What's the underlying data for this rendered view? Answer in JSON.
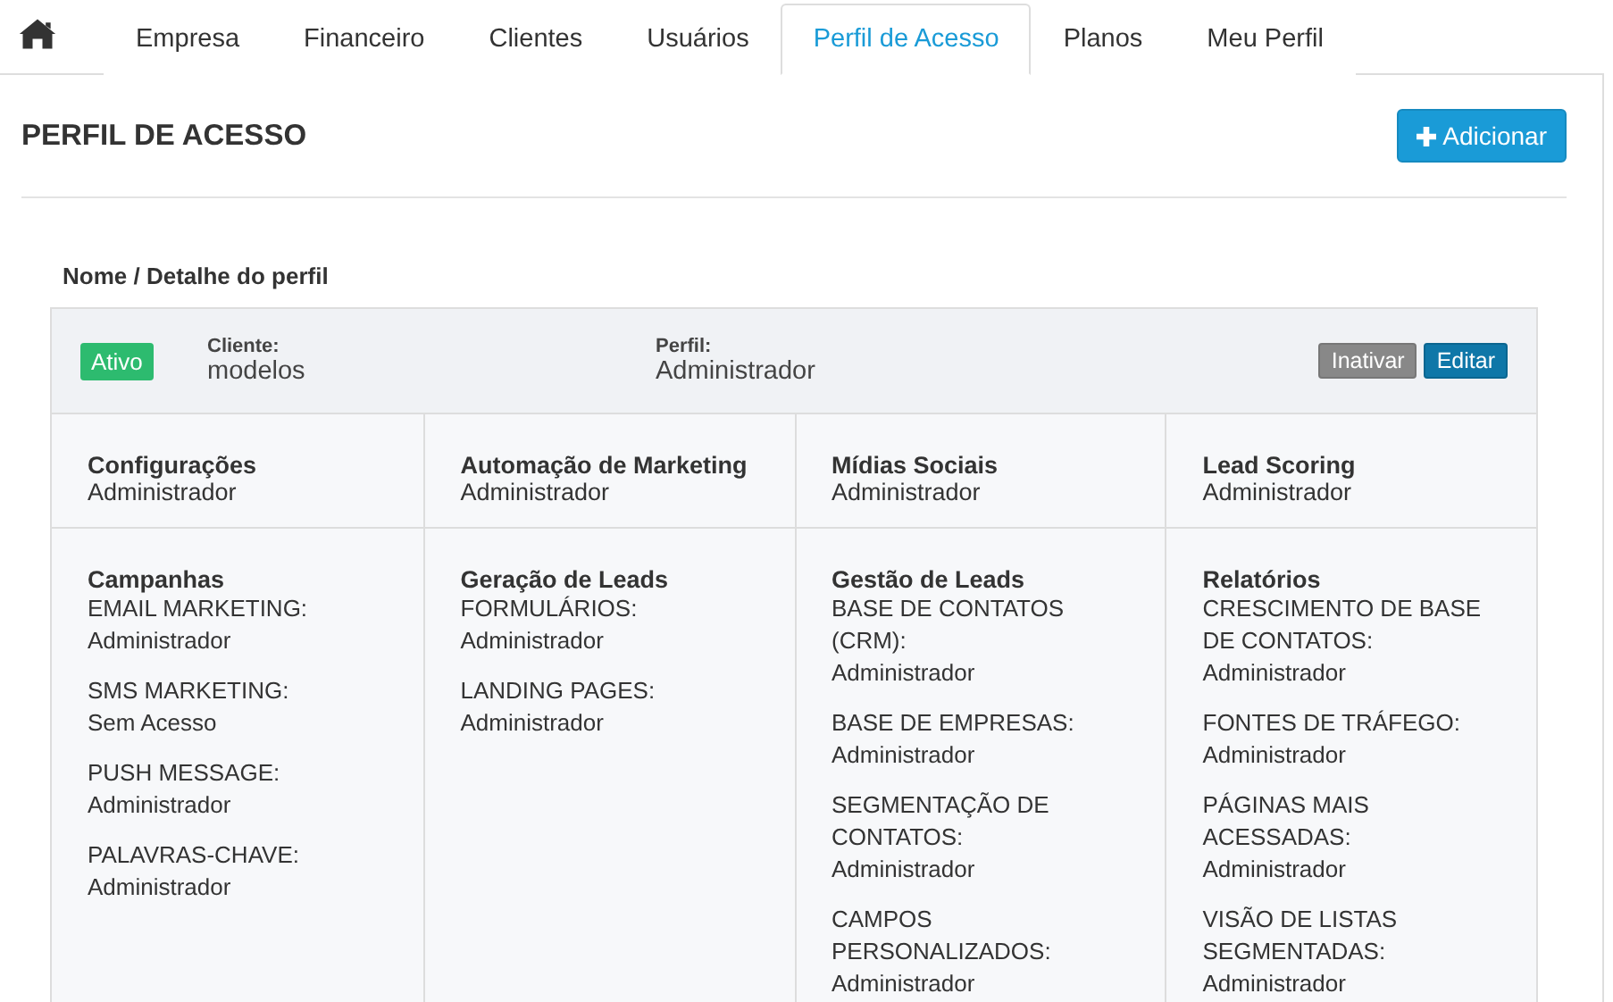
{
  "tabs": [
    {
      "label": "Empresa",
      "selected": false
    },
    {
      "label": "Financeiro",
      "selected": false
    },
    {
      "label": "Clientes",
      "selected": false
    },
    {
      "label": "Usuários",
      "selected": false
    },
    {
      "label": "Perfil de Acesso",
      "selected": true
    },
    {
      "label": "Planos",
      "selected": false
    },
    {
      "label": "Meu Perfil",
      "selected": false
    }
  ],
  "page_title": "PERFIL DE ACESSO",
  "add_button": "Adicionar",
  "section_label": "Nome / Detalhe do perfil",
  "profile": {
    "status": "Ativo",
    "client_label": "Cliente:",
    "client": "modelos",
    "profile_label": "Perfil:",
    "profile": "Administrador",
    "buttons": [
      "Inativar",
      "Editar"
    ]
  },
  "permission_rows": [
    [
      {
        "title": "Configurações",
        "value": "Administrador"
      },
      {
        "title": "Automação de Marketing",
        "value": "Administrador"
      },
      {
        "title": "Mídias Sociais",
        "value": "Administrador"
      },
      {
        "title": "Lead Scoring",
        "value": "Administrador"
      }
    ],
    [
      {
        "title": "Campanhas",
        "items": [
          {
            "label": "EMAIL MARKETING:",
            "value": "Administrador"
          },
          {
            "label": "SMS MARKETING:",
            "value": "Sem Acesso"
          },
          {
            "label": "PUSH MESSAGE:",
            "value": "Administrador"
          },
          {
            "label": "PALAVRAS-CHAVE:",
            "value": "Administrador"
          }
        ]
      },
      {
        "title": "Geração de Leads",
        "items": [
          {
            "label": "FORMULÁRIOS:",
            "value": "Administrador"
          },
          {
            "label": "LANDING PAGES:",
            "value": "Administrador"
          }
        ]
      },
      {
        "title": "Gestão de Leads",
        "items": [
          {
            "label": "BASE DE CONTATOS (CRM):",
            "value": "Administrador"
          },
          {
            "label": "BASE DE EMPRESAS:",
            "value": "Administrador"
          },
          {
            "label": "SEGMENTAÇÃO DE CONTATOS:",
            "value": "Administrador"
          },
          {
            "label": "CAMPOS PERSONALIZADOS:",
            "value": "Administrador"
          }
        ]
      },
      {
        "title": "Relatórios",
        "items": [
          {
            "label": "CRESCIMENTO DE BASE DE CONTATOS:",
            "value": "Administrador"
          },
          {
            "label": "FONTES DE TRÁFEGO:",
            "value": "Administrador"
          },
          {
            "label": "PÁGINAS MAIS ACESSADAS:",
            "value": "Administrador"
          },
          {
            "label": "VISÃO DE LISTAS SEGMENTADAS:",
            "value": "Administrador"
          }
        ]
      }
    ]
  ]
}
